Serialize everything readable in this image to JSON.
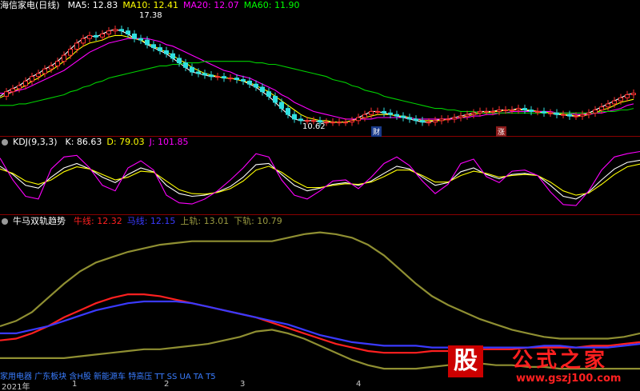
{
  "main_legend": {
    "stock": "海信家电(日线)",
    "items": [
      {
        "label": "MA5: 12.83",
        "color": "#ffffff"
      },
      {
        "label": "MA10: 12.41",
        "color": "#ffff00"
      },
      {
        "label": "MA20: 12.07",
        "color": "#ff00ff"
      },
      {
        "label": "MA60: 11.90",
        "color": "#00ff00"
      }
    ]
  },
  "kdj_legend": {
    "name": "KDJ(9,3,3)",
    "items": [
      {
        "label": "K: 86.63",
        "color": "#ffffff"
      },
      {
        "label": "D: 79.03",
        "color": "#ffff00"
      },
      {
        "label": "J: 101.85",
        "color": "#ff00ff"
      }
    ]
  },
  "trend_legend": {
    "name": "牛马双轨趋势",
    "items": [
      {
        "label": "牛线: 12.32",
        "color": "#ff2020"
      },
      {
        "label": "马线: 12.15",
        "color": "#3a3aff"
      },
      {
        "label": "上轨: 13.01",
        "color": "#9a9a40"
      },
      {
        "label": "下轨: 10.79",
        "color": "#9a9a40"
      }
    ]
  },
  "annotations": {
    "high": "17.38",
    "low": "10.62",
    "badge_cai": "财",
    "badge_zhang": "涨"
  },
  "x_axis": {
    "labels": [
      "2021年",
      "1",
      "2",
      "3",
      "4"
    ]
  },
  "footer": {
    "text": "家用电器 广东板块 含H股 新能源车 特高压 TT SS UA TA T5"
  },
  "watermark": {
    "box": "股",
    "text": "公式之家",
    "url": "www.gszj100.com"
  },
  "chart_data": [
    {
      "type": "line",
      "name": "main",
      "x": [
        0,
        8,
        16,
        24,
        32,
        40,
        48,
        56,
        64,
        72,
        80,
        88,
        96,
        104,
        112,
        120,
        128,
        136,
        144,
        152,
        160,
        168,
        176,
        184,
        192,
        200,
        208,
        216,
        224,
        232,
        240,
        248,
        256,
        264,
        272,
        280,
        288,
        296,
        304,
        312,
        320,
        328,
        336,
        344,
        352,
        360,
        368,
        376,
        384,
        392,
        400,
        408,
        416,
        424,
        432,
        440,
        448,
        456,
        464,
        472,
        480,
        488,
        496,
        504,
        512,
        520,
        528,
        536,
        544,
        552,
        560,
        568,
        576,
        584,
        592,
        600,
        608,
        616,
        624,
        632,
        640,
        648,
        656,
        664,
        672,
        680,
        688,
        696,
        704,
        712,
        720,
        728,
        736,
        744,
        752,
        760,
        768,
        776,
        784,
        792
      ],
      "series": [
        {
          "name": "MA5",
          "color": "#ffffff",
          "values": [
            12.6,
            12.9,
            13.1,
            13.3,
            13.6,
            13.9,
            14.1,
            14.4,
            14.6,
            14.9,
            15.3,
            15.7,
            16.1,
            16.4,
            16.6,
            16.5,
            16.7,
            16.9,
            17.0,
            16.9,
            16.7,
            16.4,
            16.3,
            16.0,
            15.8,
            15.6,
            15.4,
            15.1,
            14.8,
            14.5,
            14.2,
            14.1,
            14.0,
            13.9,
            13.9,
            13.8,
            13.8,
            13.7,
            13.6,
            13.4,
            13.2,
            12.9,
            12.6,
            12.2,
            11.8,
            11.4,
            11.1,
            11.0,
            11.0,
            11.0,
            10.9,
            10.9,
            10.9,
            10.9,
            10.9,
            11.0,
            11.2,
            11.4,
            11.6,
            11.6,
            11.5,
            11.4,
            11.3,
            11.2,
            11.1,
            11.0,
            10.9,
            10.9,
            11.0,
            11.1,
            11.1,
            11.2,
            11.3,
            11.4,
            11.5,
            11.6,
            11.6,
            11.6,
            11.7,
            11.7,
            11.7,
            11.8,
            11.7,
            11.6,
            11.6,
            11.5,
            11.5,
            11.4,
            11.4,
            11.3,
            11.3,
            11.4,
            11.5,
            11.7,
            11.9,
            12.1,
            12.3,
            12.5,
            12.7,
            12.8
          ]
        },
        {
          "name": "MA10",
          "color": "#ffff00",
          "values": [
            12.5,
            12.7,
            12.9,
            13.1,
            13.3,
            13.6,
            13.8,
            14.1,
            14.3,
            14.6,
            14.9,
            15.2,
            15.6,
            15.9,
            16.1,
            16.2,
            16.3,
            16.5,
            16.6,
            16.6,
            16.5,
            16.4,
            16.3,
            16.1,
            15.9,
            15.7,
            15.5,
            15.3,
            15.0,
            14.8,
            14.5,
            14.3,
            14.1,
            14.0,
            13.9,
            13.8,
            13.8,
            13.7,
            13.6,
            13.5,
            13.3,
            13.1,
            12.9,
            12.6,
            12.3,
            12.0,
            11.7,
            11.4,
            11.2,
            11.1,
            11.0,
            11.0,
            10.9,
            10.9,
            10.9,
            11.0,
            11.1,
            11.2,
            11.3,
            11.4,
            11.4,
            11.4,
            11.3,
            11.3,
            11.2,
            11.1,
            11.0,
            11.0,
            11.0,
            11.0,
            11.1,
            11.1,
            11.2,
            11.3,
            11.4,
            11.5,
            11.5,
            11.6,
            11.6,
            11.7,
            11.7,
            11.7,
            11.7,
            11.7,
            11.6,
            11.6,
            11.5,
            11.5,
            11.4,
            11.4,
            11.3,
            11.3,
            11.4,
            11.5,
            11.7,
            11.8,
            12.0,
            12.2,
            12.3,
            12.4
          ]
        },
        {
          "name": "MA20",
          "color": "#ff00ff",
          "values": [
            12.8,
            12.8,
            12.9,
            13.0,
            13.1,
            13.3,
            13.5,
            13.7,
            13.9,
            14.1,
            14.3,
            14.6,
            14.9,
            15.2,
            15.5,
            15.7,
            15.9,
            16.1,
            16.2,
            16.3,
            16.4,
            16.4,
            16.4,
            16.4,
            16.3,
            16.2,
            16.0,
            15.9,
            15.7,
            15.5,
            15.3,
            15.1,
            14.9,
            14.7,
            14.5,
            14.3,
            14.2,
            14.0,
            13.9,
            13.8,
            13.6,
            13.4,
            13.2,
            13.0,
            12.7,
            12.5,
            12.2,
            12.0,
            11.8,
            11.6,
            11.5,
            11.4,
            11.3,
            11.2,
            11.1,
            11.1,
            11.1,
            11.1,
            11.1,
            11.2,
            11.2,
            11.2,
            11.2,
            11.2,
            11.2,
            11.1,
            11.1,
            11.1,
            11.1,
            11.1,
            11.1,
            11.1,
            11.2,
            11.2,
            11.3,
            11.3,
            11.4,
            11.4,
            11.5,
            11.5,
            11.6,
            11.6,
            11.6,
            11.6,
            11.6,
            11.6,
            11.6,
            11.5,
            11.5,
            11.5,
            11.4,
            11.4,
            11.4,
            11.5,
            11.5,
            11.6,
            11.7,
            11.8,
            12.0,
            12.1
          ]
        },
        {
          "name": "MA60",
          "color": "#00d000",
          "values": [
            12.0,
            12.0,
            12.0,
            12.1,
            12.1,
            12.2,
            12.3,
            12.4,
            12.5,
            12.6,
            12.7,
            12.9,
            13.0,
            13.2,
            13.3,
            13.5,
            13.6,
            13.8,
            13.9,
            14.0,
            14.1,
            14.2,
            14.3,
            14.4,
            14.5,
            14.6,
            14.6,
            14.7,
            14.7,
            14.8,
            14.8,
            14.8,
            14.9,
            14.9,
            14.9,
            14.9,
            14.9,
            14.9,
            14.9,
            14.9,
            14.8,
            14.8,
            14.7,
            14.7,
            14.6,
            14.5,
            14.4,
            14.3,
            14.2,
            14.1,
            14.0,
            13.9,
            13.7,
            13.6,
            13.5,
            13.3,
            13.2,
            13.0,
            12.9,
            12.8,
            12.6,
            12.5,
            12.4,
            12.3,
            12.2,
            12.1,
            12.0,
            11.9,
            11.8,
            11.8,
            11.7,
            11.7,
            11.6,
            11.6,
            11.6,
            11.5,
            11.5,
            11.5,
            11.5,
            11.5,
            11.5,
            11.5,
            11.5,
            11.5,
            11.5,
            11.5,
            11.5,
            11.5,
            11.5,
            11.5,
            11.5,
            11.5,
            11.5,
            11.5,
            11.6,
            11.6,
            11.6,
            11.7,
            11.7,
            11.8
          ]
        }
      ],
      "ylim": [
        10.2,
        18.2
      ]
    },
    {
      "type": "line",
      "name": "kdj",
      "x": [
        0,
        16,
        32,
        48,
        64,
        80,
        96,
        112,
        128,
        144,
        160,
        176,
        192,
        208,
        224,
        240,
        256,
        272,
        288,
        304,
        320,
        336,
        352,
        368,
        384,
        400,
        416,
        432,
        448,
        464,
        480,
        496,
        512,
        528,
        544,
        560,
        576,
        592,
        608,
        624,
        640,
        656,
        672,
        688,
        704,
        720,
        736,
        752,
        768,
        784,
        800
      ],
      "series": [
        {
          "name": "K",
          "color": "#ffffff",
          "values": [
            75,
            60,
            40,
            35,
            55,
            72,
            80,
            70,
            55,
            45,
            60,
            72,
            65,
            40,
            25,
            20,
            22,
            28,
            38,
            55,
            78,
            80,
            60,
            40,
            30,
            35,
            42,
            45,
            40,
            48,
            62,
            75,
            70,
            55,
            40,
            45,
            65,
            72,
            60,
            52,
            60,
            62,
            58,
            40,
            20,
            15,
            28,
            50,
            70,
            82,
            86
          ]
        },
        {
          "name": "D",
          "color": "#ffff00",
          "values": [
            70,
            62,
            48,
            42,
            50,
            65,
            74,
            70,
            60,
            50,
            55,
            66,
            64,
            48,
            32,
            25,
            24,
            27,
            34,
            48,
            68,
            75,
            64,
            48,
            36,
            36,
            40,
            43,
            42,
            46,
            56,
            68,
            68,
            58,
            46,
            46,
            58,
            66,
            62,
            55,
            58,
            60,
            58,
            46,
            30,
            22,
            26,
            42,
            60,
            74,
            79
          ]
        },
        {
          "name": "J",
          "color": "#ff00ff",
          "values": [
            90,
            50,
            20,
            15,
            70,
            92,
            95,
            72,
            40,
            30,
            72,
            85,
            68,
            22,
            8,
            6,
            15,
            30,
            50,
            72,
            98,
            92,
            50,
            22,
            15,
            30,
            48,
            50,
            34,
            55,
            80,
            92,
            76,
            48,
            25,
            42,
            80,
            88,
            56,
            45,
            66,
            68,
            58,
            28,
            5,
            3,
            30,
            68,
            92,
            98,
            102
          ]
        }
      ],
      "ylim": [
        -10,
        110
      ]
    },
    {
      "type": "line",
      "name": "trend",
      "x": [
        0,
        20,
        40,
        60,
        80,
        100,
        120,
        140,
        160,
        180,
        200,
        220,
        240,
        260,
        280,
        300,
        320,
        340,
        360,
        380,
        400,
        420,
        440,
        460,
        480,
        500,
        520,
        540,
        560,
        580,
        600,
        620,
        640,
        660,
        680,
        700,
        720,
        740,
        760,
        780,
        800
      ],
      "series": [
        {
          "name": "牛线",
          "color": "#ff2020",
          "values": [
            12.4,
            12.5,
            12.8,
            13.2,
            13.7,
            14.1,
            14.5,
            14.8,
            15.0,
            15.0,
            14.9,
            14.7,
            14.5,
            14.3,
            14.1,
            13.9,
            13.7,
            13.4,
            13.1,
            12.8,
            12.5,
            12.2,
            12.0,
            11.8,
            11.7,
            11.7,
            11.7,
            11.8,
            11.8,
            11.8,
            11.9,
            11.9,
            11.9,
            12.0,
            12.0,
            12.0,
            12.0,
            12.1,
            12.1,
            12.2,
            12.3
          ]
        },
        {
          "name": "马线",
          "color": "#3a3aff",
          "values": [
            12.8,
            12.8,
            13.0,
            13.2,
            13.5,
            13.8,
            14.1,
            14.3,
            14.5,
            14.6,
            14.6,
            14.6,
            14.5,
            14.3,
            14.1,
            13.9,
            13.7,
            13.5,
            13.3,
            13.0,
            12.7,
            12.5,
            12.3,
            12.2,
            12.1,
            12.1,
            12.1,
            12.0,
            12.0,
            12.0,
            12.0,
            12.0,
            12.0,
            12.0,
            12.1,
            12.1,
            12.0,
            12.0,
            12.0,
            12.1,
            12.2
          ]
        },
        {
          "name": "上轨",
          "color": "#8f8f32",
          "values": [
            13.2,
            13.5,
            14.0,
            14.8,
            15.6,
            16.3,
            16.8,
            17.1,
            17.4,
            17.6,
            17.8,
            17.9,
            18.0,
            18.0,
            18.0,
            18.0,
            18.0,
            18.0,
            18.2,
            18.4,
            18.5,
            18.4,
            18.2,
            17.8,
            17.2,
            16.4,
            15.6,
            14.9,
            14.4,
            14.0,
            13.6,
            13.3,
            13.0,
            12.8,
            12.6,
            12.5,
            12.5,
            12.5,
            12.5,
            12.6,
            12.8
          ]
        },
        {
          "name": "下轨",
          "color": "#8f8f32",
          "values": [
            11.4,
            11.4,
            11.4,
            11.4,
            11.4,
            11.5,
            11.6,
            11.7,
            11.8,
            11.9,
            11.9,
            12.0,
            12.1,
            12.2,
            12.4,
            12.6,
            12.9,
            13.0,
            12.8,
            12.5,
            12.1,
            11.7,
            11.3,
            11.0,
            10.8,
            10.8,
            10.8,
            10.9,
            11.0,
            11.1,
            11.1,
            11.0,
            11.0,
            10.9,
            10.9,
            10.8,
            10.8,
            10.8,
            10.8,
            10.8,
            10.8
          ]
        }
      ],
      "ylim": [
        10.4,
        18.8
      ]
    }
  ]
}
